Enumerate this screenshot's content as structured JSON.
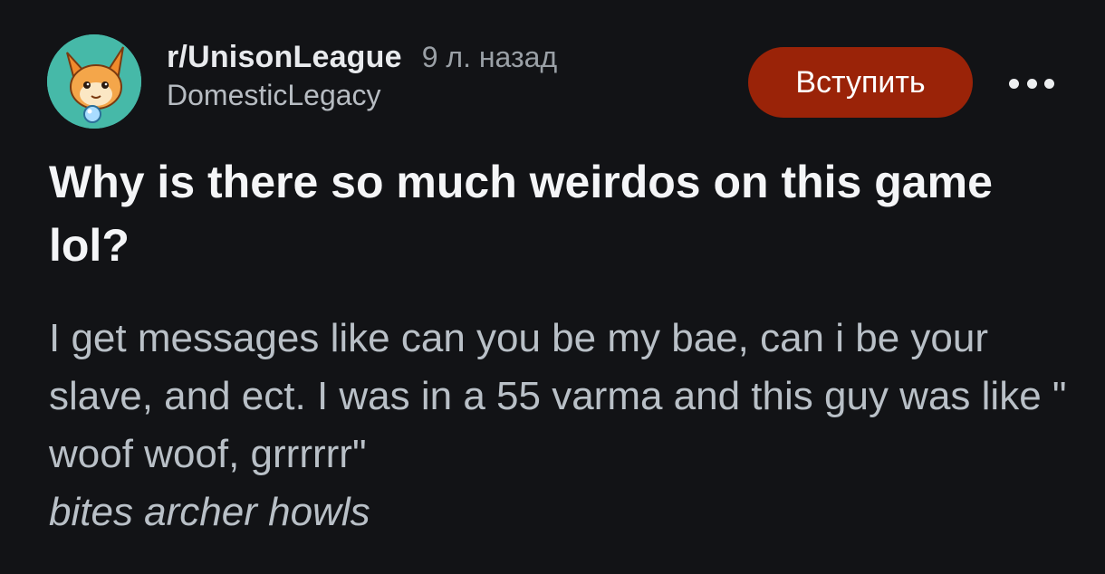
{
  "post": {
    "subreddit": "r/UnisonLeague",
    "time_ago": "9 л. назад",
    "author": "DomesticLegacy",
    "join_label": "Вступить",
    "title": "Why is there so much weirdos on this game lol?",
    "body": "I get messages like can you be my bae, can i be your slave, and ect. I was in a 55 varma and this guy was like \" woof woof, grrrrrr\"",
    "body_italic": "bites archer howls"
  },
  "icons": {
    "avatar": "subreddit-avatar-icon",
    "more": "more-options-icon"
  },
  "colors": {
    "background": "#121316",
    "join_button": "#9a2308",
    "avatar_bg": "#46b9a8"
  }
}
